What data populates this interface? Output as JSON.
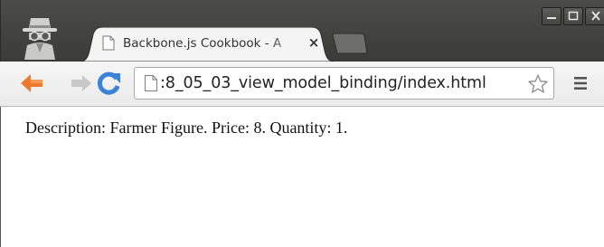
{
  "browser": {
    "tab": {
      "title": "Backbone.js Cookbook - A",
      "close_symbol": "×",
      "favicon": "page-icon"
    },
    "incognito_icon": "incognito-icon",
    "window_controls": [
      "minimize-icon",
      "maximize-icon",
      "close-icon"
    ],
    "toolbar": {
      "back_icon": "back-arrow-icon",
      "forward_icon": "forward-arrow-icon",
      "reload_icon": "reload-icon",
      "url": ":8_05_03_view_model_binding/index.html",
      "bookmark_icon": "star-icon",
      "menu_icon": "hamburger-menu-icon"
    },
    "colors": {
      "titlebar": "#3f403b",
      "back_arrow": "#f07a2b",
      "reload": "#3c82d8",
      "forward_arrow_disabled": "#c8c8c8"
    }
  },
  "page": {
    "text": "Description: Farmer Figure. Price: 8. Quantity: 1."
  }
}
